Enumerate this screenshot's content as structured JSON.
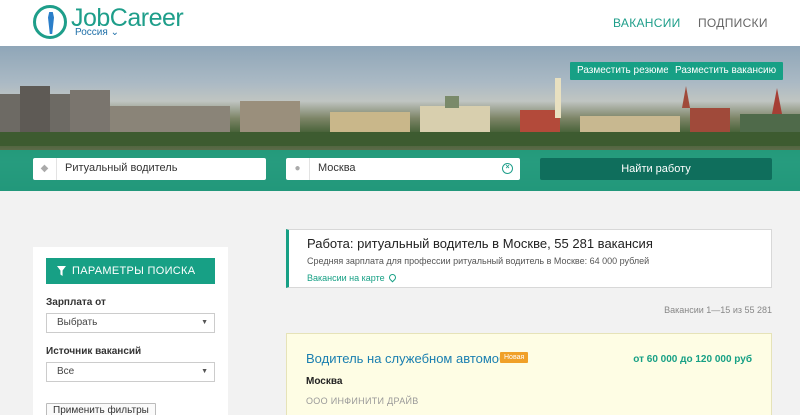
{
  "brand": {
    "name": "JobCareer",
    "region": "Россия"
  },
  "nav": {
    "vacancies": "ВАКАНСИИ",
    "subscriptions": "ПОДПИСКИ"
  },
  "hero": {
    "post_resume": "Разместить резюме",
    "post_vacancy": "Разместить вакансию",
    "search_query": "Ритуальный водитель",
    "search_city": "Москва",
    "find_button": "Найти работу"
  },
  "filters": {
    "header": "ПАРАМЕТРЫ ПОИСКА",
    "salary_label": "Зарплата от",
    "salary_value": "Выбрать",
    "source_label": "Источник вакансий",
    "source_value": "Все",
    "apply": "Применить фильтры"
  },
  "summary": {
    "title": "Работа: ритуальный водитель в Москве, 55 281 вакансия",
    "salary": "Средняя зарплата для профессии ритуальный водитель в Москве: 64 000 рублей",
    "map_link": "Вакансии на карте"
  },
  "count": "Вакансии 1—15 из 55 281",
  "job": {
    "title": "Водитель на служебном автомобиле",
    "badge": "Новая",
    "salary": "от 60 000 до 120 000 руб",
    "city": "Москва",
    "company": "ООО ИНФИНИТИ ДРАЙВ"
  },
  "colors": {
    "accent": "#17a085",
    "link": "#1a7fb0",
    "badge": "#f0a028",
    "dark_button": "#0f6e5c"
  }
}
